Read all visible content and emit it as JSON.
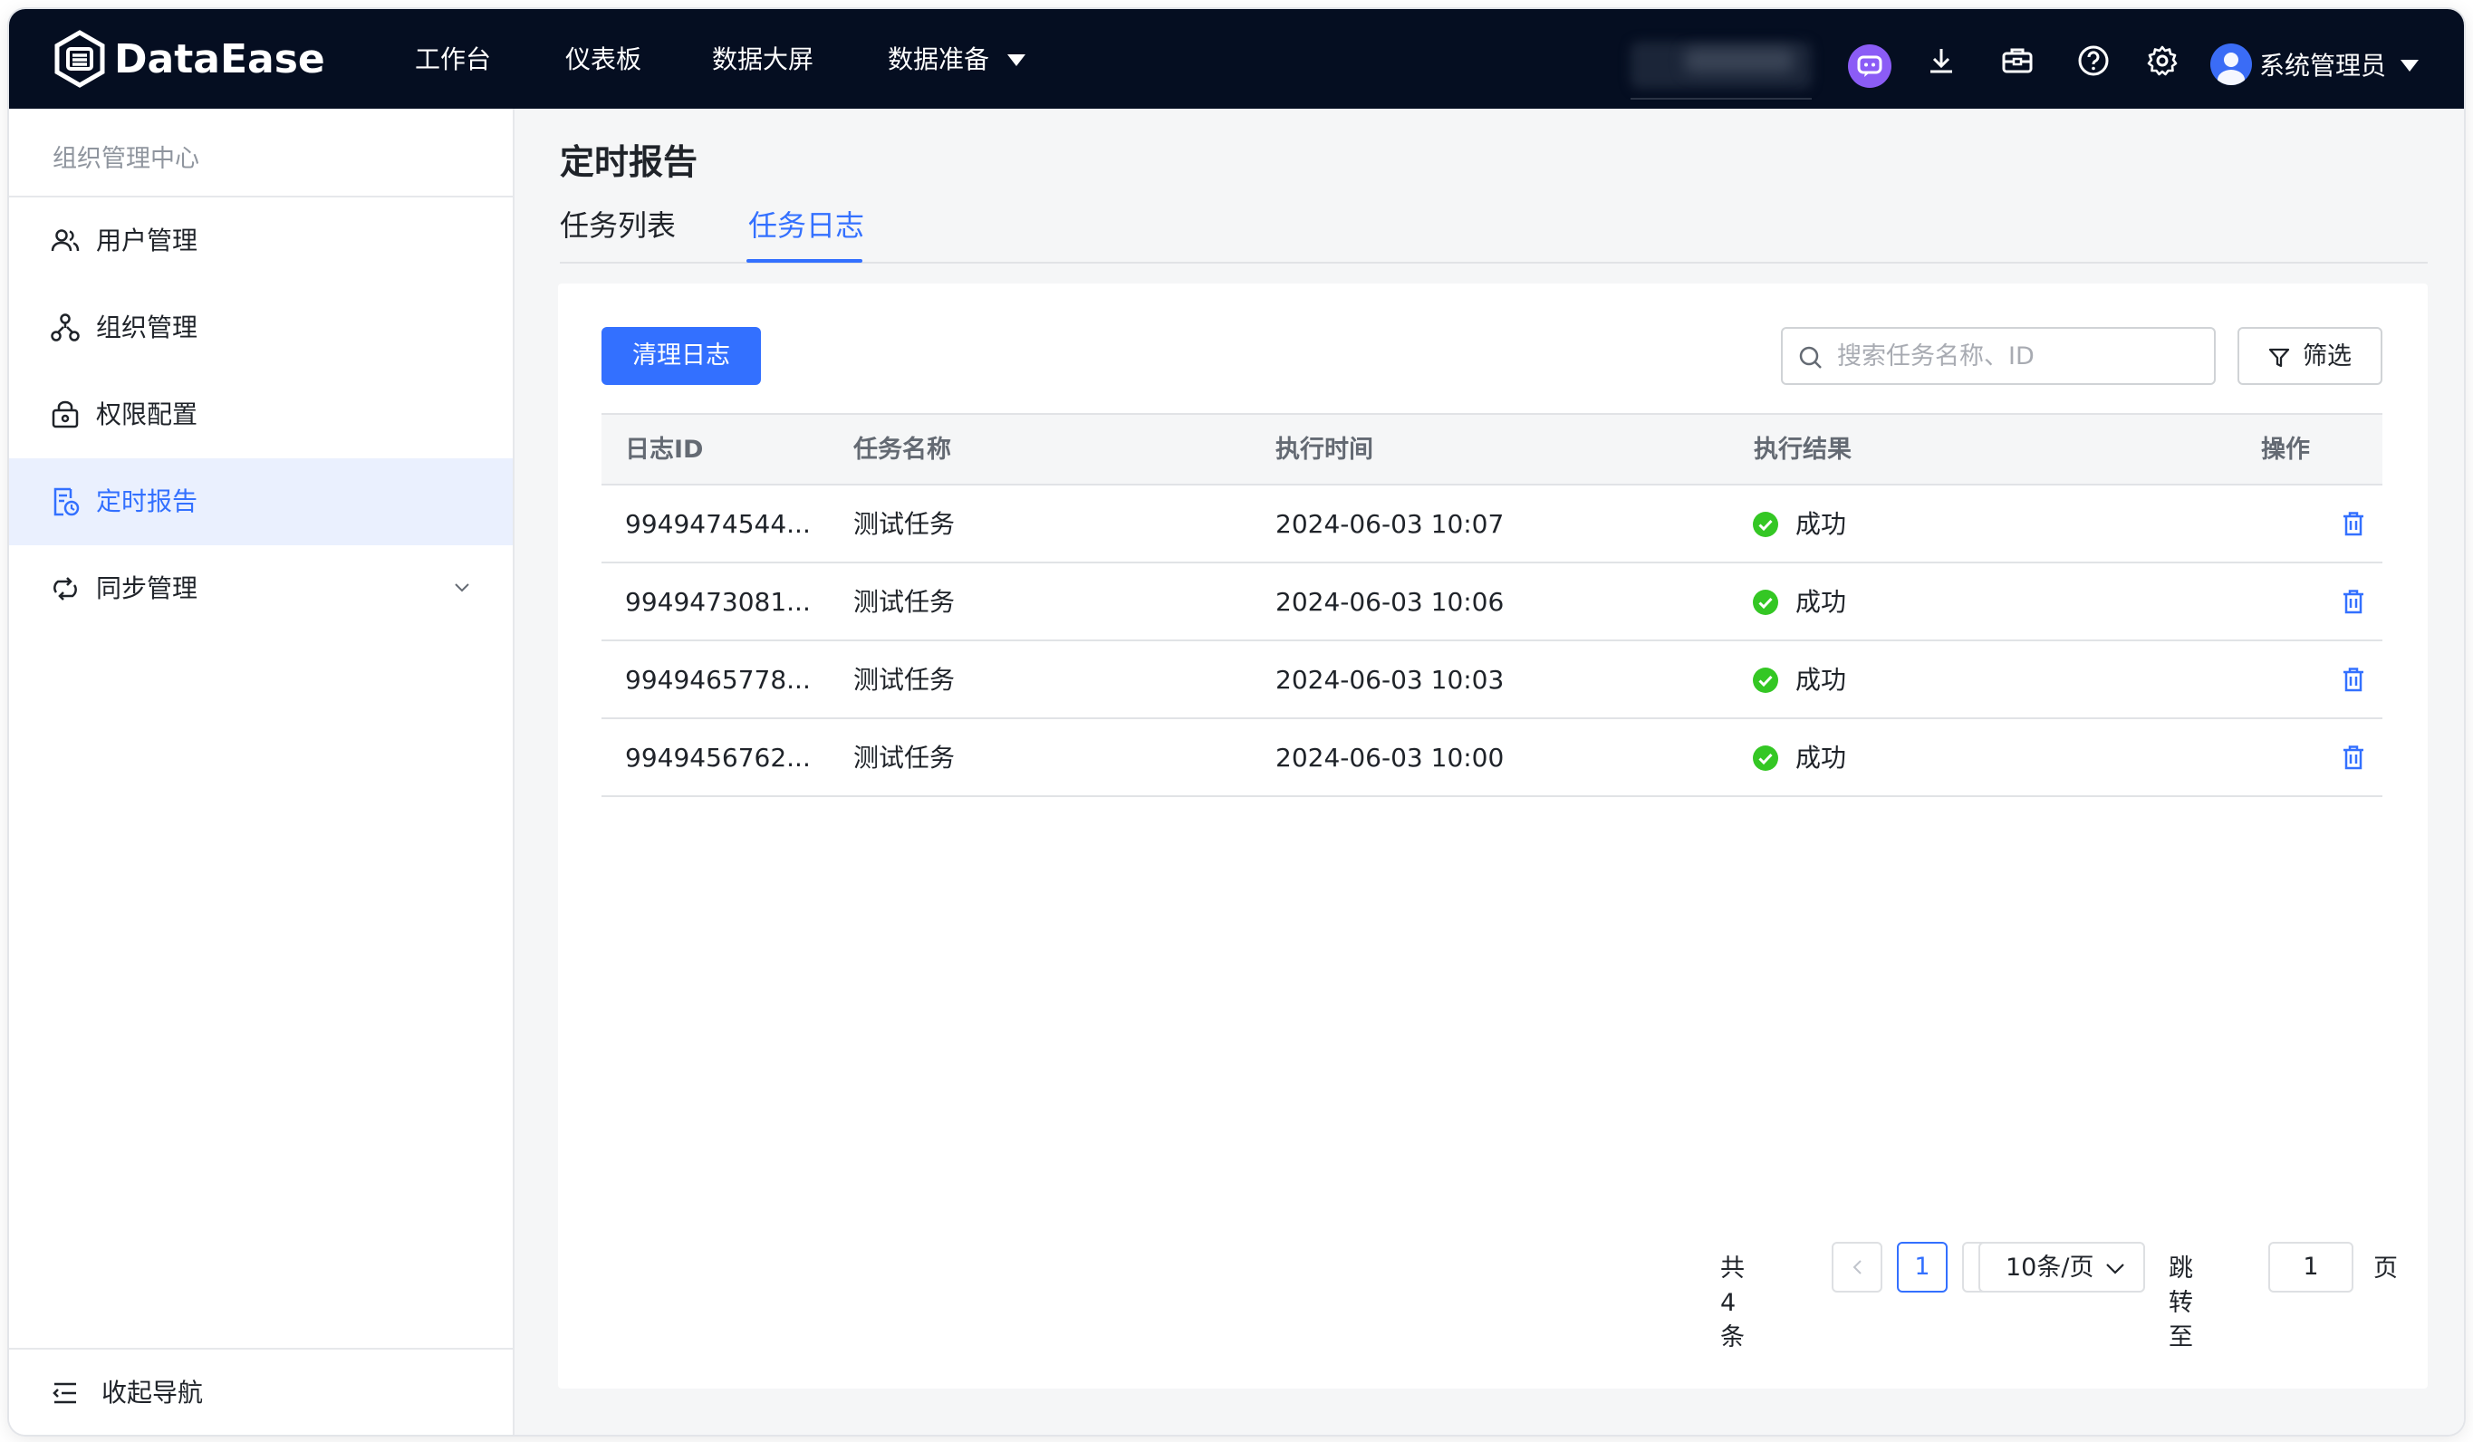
{
  "app": {
    "name": "DataEase"
  },
  "topnav": {
    "items": [
      {
        "label": "工作台"
      },
      {
        "label": "仪表板"
      },
      {
        "label": "数据大屏"
      },
      {
        "label": "数据准备"
      }
    ],
    "user_name": "系统管理员",
    "icons": [
      "ai-assistant-icon",
      "download-icon",
      "toolbox-icon",
      "help-icon",
      "settings-icon"
    ]
  },
  "sidebar": {
    "header": "组织管理中心",
    "items": [
      {
        "label": "用户管理",
        "icon": "users-icon"
      },
      {
        "label": "组织管理",
        "icon": "org-tree-icon"
      },
      {
        "label": "权限配置",
        "icon": "lock-icon"
      },
      {
        "label": "定时报告",
        "icon": "scheduled-report-icon",
        "active": true
      },
      {
        "label": "同步管理",
        "icon": "sync-icon"
      }
    ],
    "collapse_label": "收起导航"
  },
  "page": {
    "title": "定时报告",
    "tabs": [
      {
        "label": "任务列表"
      },
      {
        "label": "任务日志",
        "active": true
      }
    ]
  },
  "toolbar": {
    "clear_label": "清理日志",
    "search_placeholder": "搜索任务名称、ID",
    "filter_label": "筛选"
  },
  "table": {
    "columns": [
      "日志ID",
      "任务名称",
      "执行时间",
      "执行结果",
      "操作"
    ],
    "rows": [
      {
        "id": "9949474544...",
        "name": "测试任务",
        "time": "2024-06-03 10:07",
        "result": "成功"
      },
      {
        "id": "9949473081...",
        "name": "测试任务",
        "time": "2024-06-03 10:06",
        "result": "成功"
      },
      {
        "id": "9949465778...",
        "name": "测试任务",
        "time": "2024-06-03 10:03",
        "result": "成功"
      },
      {
        "id": "9949456762...",
        "name": "测试任务",
        "time": "2024-06-03 10:00",
        "result": "成功"
      }
    ]
  },
  "pagination": {
    "total_text": "共 4 条",
    "current_page": "1",
    "page_size": "10条/页",
    "jump_label": "跳转至",
    "jump_value": "1",
    "unit": "页"
  },
  "colors": {
    "primary": "#3370ff",
    "topbar": "#050e21",
    "success": "#34c724",
    "active_bg": "#eaf0fe"
  }
}
